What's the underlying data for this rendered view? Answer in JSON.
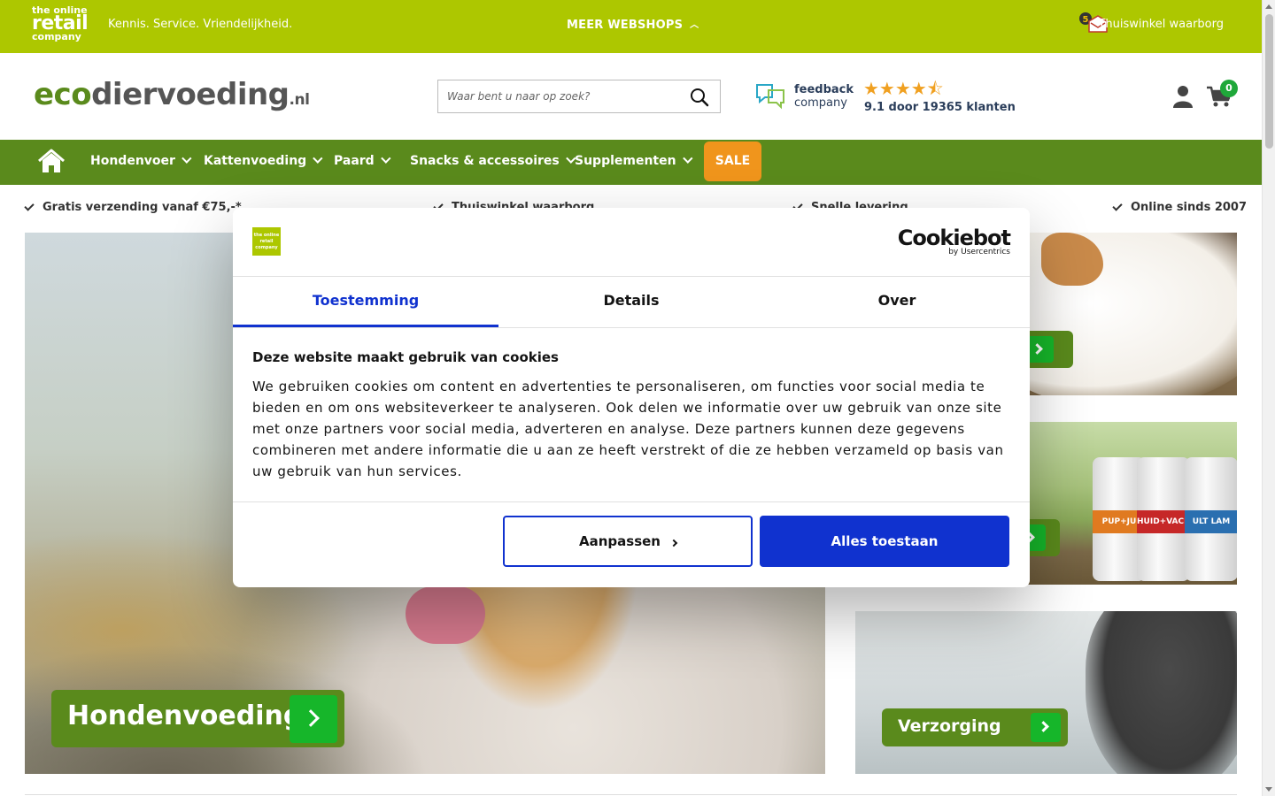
{
  "topbar": {
    "brand_line1": "the online",
    "brand_line2": "retail",
    "brand_line3": "company",
    "tagline": "Kennis. Service. Vriendelijkheid.",
    "more_webshops": "MEER WEBSHOPS",
    "waarborg": "Thuiswinkel waarborg",
    "bg_color": "#adc700"
  },
  "header": {
    "logo_eco": "eco",
    "logo_rest": "diervoeding",
    "logo_tld": ".nl",
    "search_placeholder": "Waar bent u naar op zoek?",
    "feedback_line1": "feedback",
    "feedback_line2": "company",
    "stars": "★★★★⯪",
    "rating_text": "9.1 door 19365 klanten",
    "cart_count": "0"
  },
  "nav": {
    "items": [
      {
        "label": "Hondenvoer"
      },
      {
        "label": "Kattenvoeding"
      },
      {
        "label": "Paard"
      },
      {
        "label": "Snacks & accessoires"
      },
      {
        "label": "Supplementen"
      }
    ],
    "sale": "SALE",
    "bg_color": "#5a8a1c",
    "sale_color": "#f0951c"
  },
  "usps": [
    "Gratis verzending vanaf €75,-*",
    "Thuiswinkel waarborg",
    "Snelle levering",
    "Online sinds 2007"
  ],
  "tiles": {
    "hero_label": "Hondenvoeding",
    "can_labels": [
      "PUP+JU",
      "HUID+VACHT",
      "ULT LAM"
    ],
    "care_label": "Verzorging"
  },
  "cookie_dialog": {
    "brand_logo": "the online retail company",
    "provider": "Cookiebot",
    "provider_sub": "by Usercentrics",
    "tabs": [
      {
        "label": "Toestemming",
        "active": true
      },
      {
        "label": "Details",
        "active": false
      },
      {
        "label": "Over",
        "active": false
      }
    ],
    "title": "Deze website maakt gebruik van cookies",
    "body": "We gebruiken cookies om content en advertenties te personaliseren, om functies voor social media te bieden en om ons websiteverkeer te analyseren. Ook delen we informatie over uw gebruik van onze site met onze partners voor social media, adverteren en analyse. Deze partners kunnen deze gegevens combineren met andere informatie die u aan ze heeft verstrekt of die ze hebben verzameld op basis van uw gebruik van hun services.",
    "btn_adjust": "Aanpassen",
    "btn_allow": "Alles toestaan",
    "accent_color": "#1032cf"
  }
}
